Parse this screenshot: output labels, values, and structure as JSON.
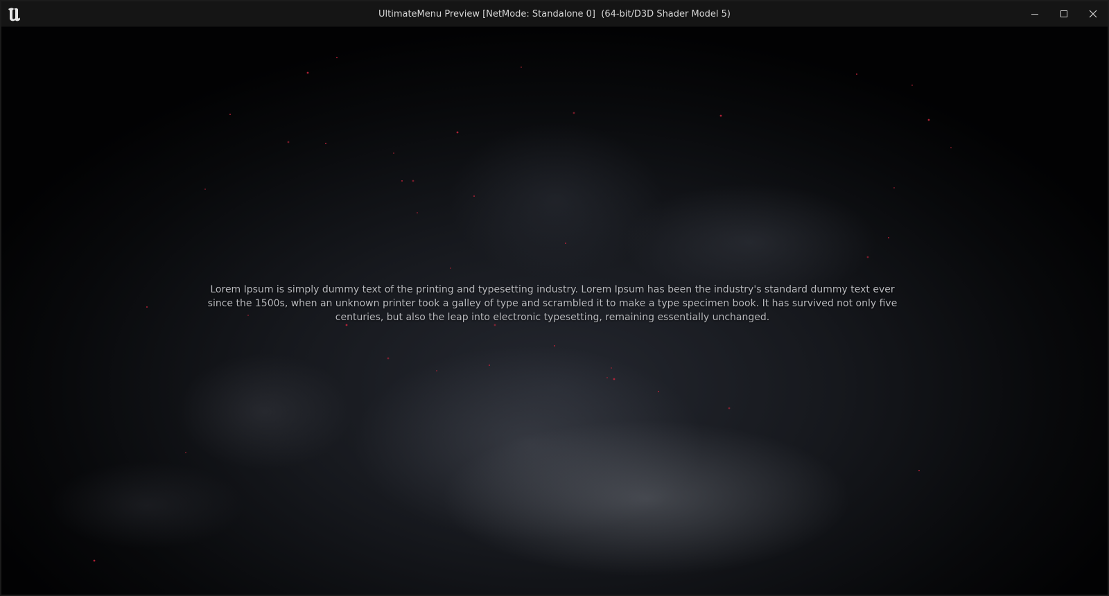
{
  "window": {
    "title": "UltimateMenu Preview [NetMode: Standalone 0]  (64-bit/D3D Shader Model 5)",
    "logo_icon": "unreal-engine-logo-icon",
    "controls": {
      "minimize_icon": "minimize-icon",
      "maximize_icon": "maximize-icon",
      "close_icon": "close-icon"
    }
  },
  "viewport": {
    "body_text": "Lorem Ipsum is simply dummy text of the printing and typesetting industry. Lorem Ipsum has been the industry's standard dummy text ever since the 1500s, when an unknown printer took a galley of type and scrambled it to make a type specimen book. It has survived not only five centuries, but also the leap into electronic typesetting, remaining essentially unchanged.",
    "particle_color": "#c0243a",
    "background_color": "#16181d"
  }
}
